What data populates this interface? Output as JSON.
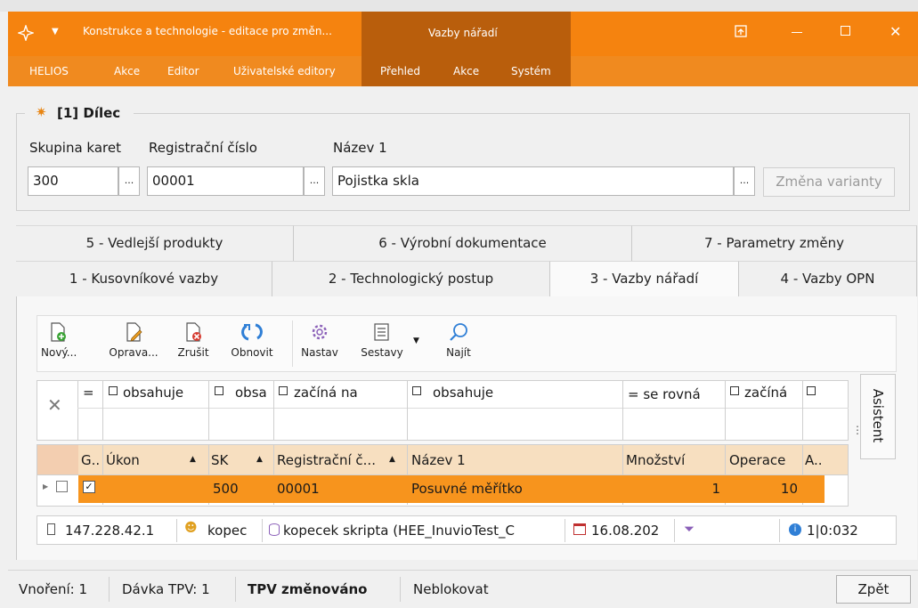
{
  "window": {
    "app_title": "Konstrukce a technologie - editace pro změn...",
    "context_title": "Vazby nářadí"
  },
  "menu": {
    "left": [
      "HELIOS",
      "Akce",
      "Editor",
      "Uživatelské editory"
    ],
    "context": [
      "Přehled",
      "Akce",
      "Systém"
    ]
  },
  "header": {
    "title": "[1] Dílec",
    "labels": {
      "skupina": "Skupina karet",
      "registracni": "Registrační číslo",
      "nazev": "Název 1"
    },
    "values": {
      "skupina": "300",
      "registracni": "00001",
      "nazev": "Pojistka skla"
    },
    "dots": "...",
    "zmena_varianty": "Změna varianty"
  },
  "tabs_top": [
    "5 - Vedlejší produkty",
    "6 - Výrobní dokumentace",
    "7 - Parametry změny"
  ],
  "tabs_bottom": [
    "1 - Kusovníkové vazby",
    "2 - Technologický postup",
    "3 - Vazby nářadí",
    "4 - Vazby OPN"
  ],
  "toolbar": [
    "Nový...",
    "Oprava...",
    "Zrušit",
    "Obnovit",
    "Nastav",
    "Sestavy",
    "Najít"
  ],
  "filter": {
    "eq": "=",
    "cells": [
      "obsahuje",
      "obsa",
      "začíná na",
      "obsahuje",
      "= se rovná",
      "začíná",
      ""
    ]
  },
  "grid": {
    "headers": [
      "G..",
      "Úkon",
      "SK",
      "Registrační č...",
      "Název 1",
      "Množství",
      "Operace",
      "A.."
    ],
    "row": {
      "sk": "500",
      "reg": "00001",
      "nazev": "Posuvné měřítko",
      "mnozstvi": "1",
      "operace": "10"
    },
    "side": "Asistent"
  },
  "statusgrid": {
    "ip": "147.228.42.1",
    "user": "kopec",
    "db": "kopecek skripta (HEE_InuvioTest_C",
    "date": "16.08.202",
    "info": "1|0:032"
  },
  "statusbar": {
    "vnoreni": "Vnoření: 1",
    "davka": "Dávka TPV: 1",
    "tpv": "TPV změnováno",
    "neblok": "Neblokovat",
    "zpet": "Zpět"
  },
  "colors": {
    "accent": "#f5830f",
    "accent_dark": "#b95e0c",
    "row_select": "#f7941d"
  }
}
